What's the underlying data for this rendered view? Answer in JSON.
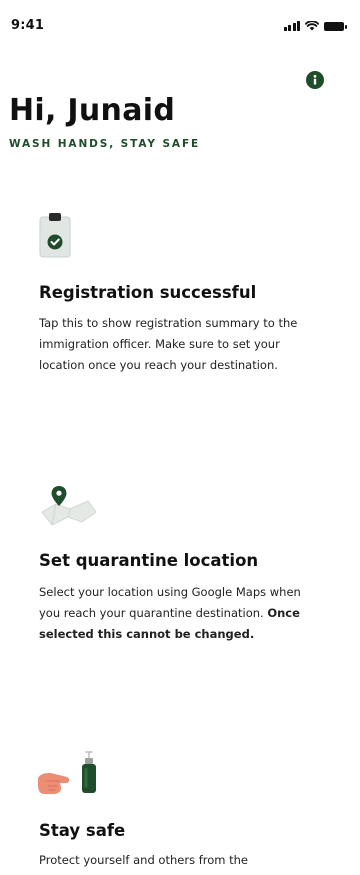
{
  "status_bar": {
    "time": "9:41"
  },
  "header": {
    "greeting": "Hi, Junaid",
    "tagline": "WASH HANDS, STAY SAFE",
    "info_icon": "info-icon"
  },
  "cards": [
    {
      "icon": "clipboard-check-icon",
      "title": "Registration successful",
      "description": "Tap this to show registration summary to the immigration officer.  Make sure to set your location once you reach your destination."
    },
    {
      "icon": "map-pin-icon",
      "title": "Set quarantine location",
      "description_plain": "Select your location using Google Maps when you reach your quarantine destination. ",
      "description_bold": "Once selected this cannot be changed."
    },
    {
      "icon": "hand-sanitizer-icon",
      "title": "Stay safe",
      "description": "Protect yourself and others from the"
    }
  ],
  "colors": {
    "accent": "#1f4d2b",
    "icon_bg": "#e3e8e4"
  }
}
